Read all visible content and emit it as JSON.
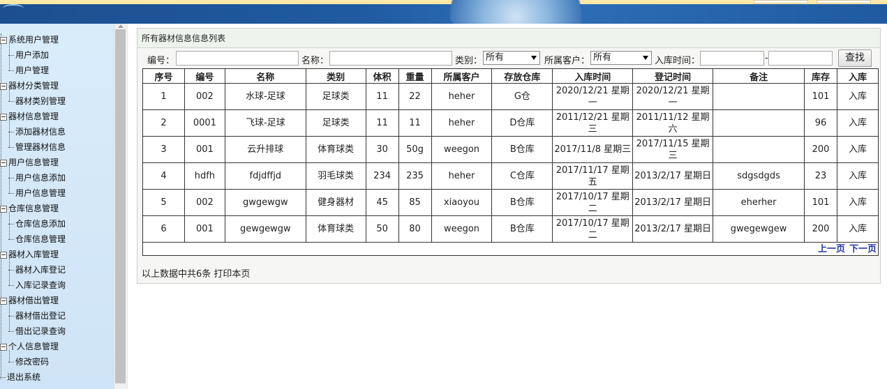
{
  "sidebar": {
    "groups": [
      {
        "label": "系统用户管理",
        "items": [
          "用户添加",
          "用户管理"
        ]
      },
      {
        "label": "器材分类管理",
        "items": [
          "器材类别管理"
        ]
      },
      {
        "label": "器材信息管理",
        "items": [
          "添加器材信息",
          "管理器材信息"
        ]
      },
      {
        "label": "用户信息管理",
        "items": [
          "用户信息添加",
          "用户信息管理"
        ]
      },
      {
        "label": "仓库信息管理",
        "items": [
          "仓库信息添加",
          "仓库信息管理"
        ]
      },
      {
        "label": "器材入库管理",
        "items": [
          "器材入库登记",
          "入库记录查询"
        ]
      },
      {
        "label": "器材借出管理",
        "items": [
          "器材借出登记",
          "借出记录查询"
        ]
      },
      {
        "label": "个人信息管理",
        "items": [
          "修改密码"
        ]
      }
    ],
    "logout": "退出系统"
  },
  "panel": {
    "title": "所有器材信息信息列表"
  },
  "search": {
    "code_label": "编号：",
    "name_label": "名称：",
    "category_label": "类别：",
    "category_value": "所有",
    "client_label": "所属客户：",
    "client_value": "所有",
    "date_label": "入库时间：",
    "date_sep": "-",
    "button": "查找"
  },
  "table": {
    "headers": [
      "序号",
      "编号",
      "名称",
      "类别",
      "体积",
      "重量",
      "所属客户",
      "存放仓库",
      "入库时间",
      "登记时间",
      "备注",
      "库存",
      "入库"
    ],
    "rows": [
      [
        "1",
        "002",
        "水球-足球",
        "足球类",
        "11",
        "22",
        "heher",
        "G仓",
        "2020/12/21 星期一",
        "2020/12/21 星期一",
        "",
        "101",
        "入库"
      ],
      [
        "2",
        "0001",
        "飞球-足球",
        "足球类",
        "11",
        "11",
        "heher",
        "D仓库",
        "2011/12/21 星期三",
        "2011/11/12 星期六",
        "",
        "96",
        "入库"
      ],
      [
        "3",
        "001",
        "云升排球",
        "体育球类",
        "30",
        "50g",
        "weegon",
        "B仓库",
        "2017/11/8 星期三",
        "2017/11/15 星期三",
        "",
        "200",
        "入库"
      ],
      [
        "4",
        "hdfh",
        "fdjdffjd",
        "羽毛球类",
        "234",
        "235",
        "heher",
        "C仓库",
        "2017/11/17 星期五",
        "2013/2/17 星期日",
        "sdgsdgds",
        "23",
        "入库"
      ],
      [
        "5",
        "002",
        "gwgewgw",
        "健身器材",
        "45",
        "85",
        "xiaoyou",
        "B仓库",
        "2017/10/17 星期二",
        "2013/2/17 星期日",
        "eherher",
        "101",
        "入库"
      ],
      [
        "6",
        "001",
        "gewgewgw",
        "体育球类",
        "50",
        "80",
        "weegon",
        "B仓库",
        "2017/10/17 星期二",
        "2013/2/17 星期日",
        "gwegewgew",
        "200",
        "入库"
      ]
    ],
    "prev": "上一页",
    "next": "下一页"
  },
  "footer": {
    "count_text": "以上数据中共6条",
    "print": "打印本页"
  },
  "colors": {
    "banner": "#1f5aa0",
    "sidebar": "#d4e8f8",
    "link": "#1f33a8"
  }
}
